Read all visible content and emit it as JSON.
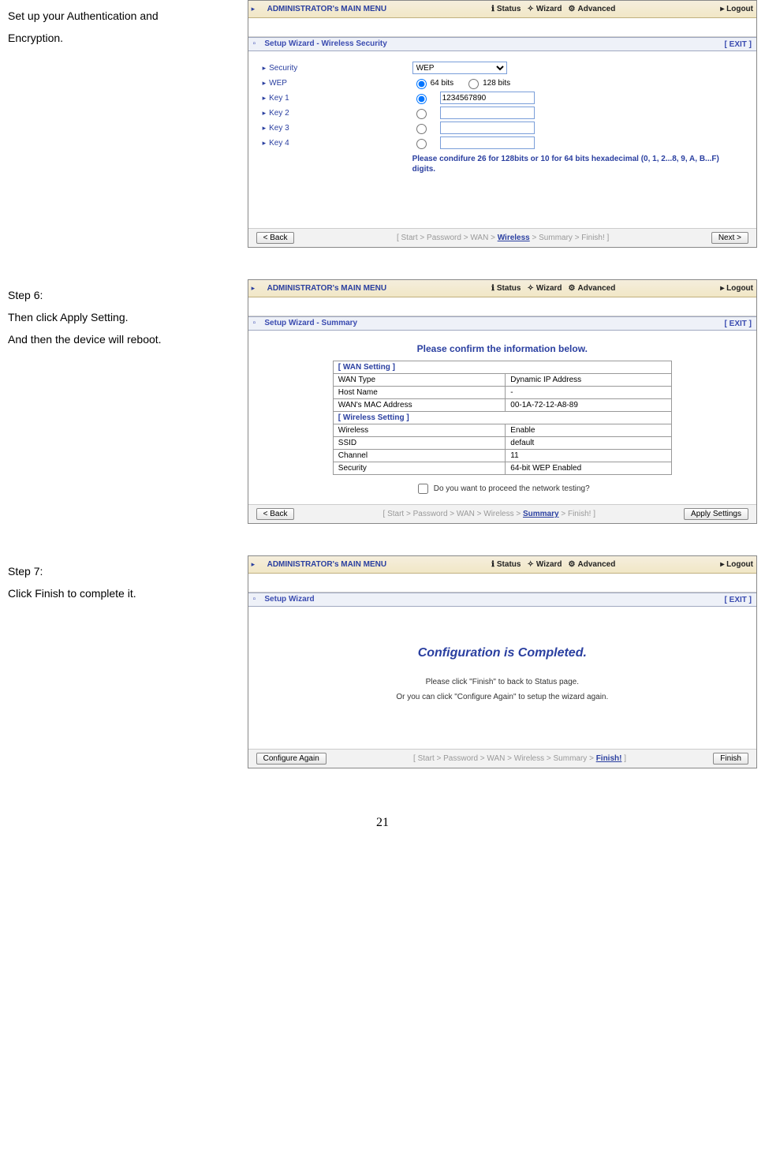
{
  "page_number": "21",
  "steps": {
    "s5": {
      "text_a": "Set up your Authentication and",
      "text_b": "Encryption."
    },
    "s6": {
      "title": "Step 6:",
      "line1": "Then click Apply Setting.",
      "line2": "And then the device will reboot."
    },
    "s7": {
      "title": "Step 7:",
      "line1": "Click Finish to complete it."
    }
  },
  "nav": {
    "brand_prefix": "ADMINISTRATOR's ",
    "brand_suffix": "MAIN MENU",
    "status": "Status",
    "wizard": "Wizard",
    "advanced": "Advanced",
    "logout": "Logout"
  },
  "panel1": {
    "header": "Setup Wizard - Wireless Security",
    "exit": "[ EXIT ]",
    "labels": {
      "security": "Security",
      "wep": "WEP",
      "k1": "Key 1",
      "k2": "Key 2",
      "k3": "Key 3",
      "k4": "Key 4"
    },
    "security_value": "WEP",
    "bits64": "64 bits",
    "bits128": "128 bits",
    "key1_value": "1234567890",
    "note": "Please condifure 26 for 128bits or 10 for 64 bits hexadecimal (0, 1, 2...8, 9, A, B...F) digits.",
    "back": "< Back",
    "next": "Next >",
    "crumb_pre": "[ Start > Password > WAN > ",
    "crumb_cur": "Wireless",
    "crumb_post": " > Summary > Finish! ]"
  },
  "panel2": {
    "header": "Setup Wizard - Summary",
    "exit": "[ EXIT ]",
    "title": "Please confirm the information below.",
    "grp_wan": "[ WAN Setting ]",
    "rows_wan": [
      {
        "k": "WAN Type",
        "v": "Dynamic IP Address"
      },
      {
        "k": "Host Name",
        "v": "-"
      },
      {
        "k": "WAN's MAC Address",
        "v": "00-1A-72-12-A8-89"
      }
    ],
    "grp_wifi": "[ Wireless Setting ]",
    "rows_wifi": [
      {
        "k": "Wireless",
        "v": "Enable"
      },
      {
        "k": "SSID",
        "v": "default"
      },
      {
        "k": "Channel",
        "v": "11"
      },
      {
        "k": "Security",
        "v": "64-bit WEP Enabled"
      }
    ],
    "proceed": "Do you want to proceed the network testing?",
    "back": "< Back",
    "apply": "Apply Settings",
    "crumb_pre": "[ Start > Password > WAN > Wireless > ",
    "crumb_cur": "Summary",
    "crumb_post": " > Finish! ]"
  },
  "panel3": {
    "header": "Setup Wizard",
    "exit": "[ EXIT ]",
    "title": "Configuration is Completed.",
    "line1": "Please click \"Finish\" to back to Status page.",
    "line2": "Or you can click \"Configure Again\" to setup the wizard again.",
    "configure": "Configure Again",
    "finish": "Finish",
    "crumb_pre": "[ Start > Password > WAN > Wireless > Summary > ",
    "crumb_cur": "Finish!",
    "crumb_post": " ]"
  }
}
